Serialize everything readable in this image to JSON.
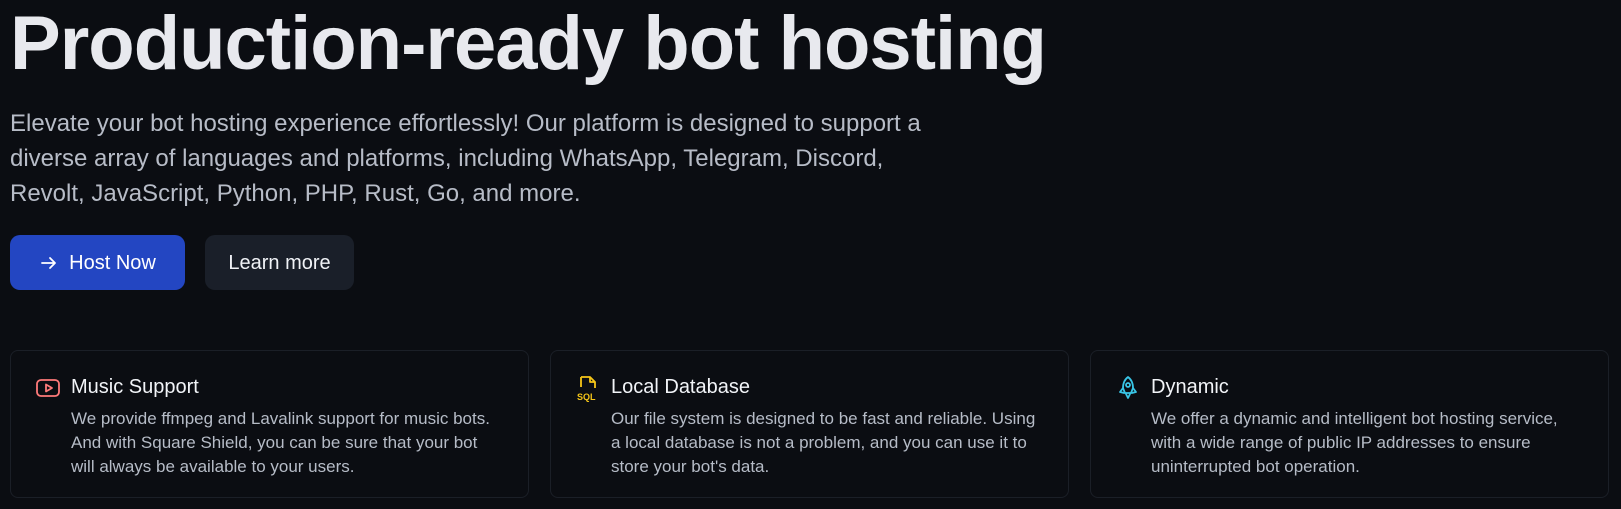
{
  "hero": {
    "title": "Production-ready bot hosting",
    "description": "Elevate your bot hosting experience effortlessly! Our platform is designed to support a diverse array of languages and platforms, including WhatsApp, Telegram, Discord, Revolt, JavaScript, Python, PHP, Rust, Go, and more.",
    "buttons": {
      "primary_label": "Host Now",
      "secondary_label": "Learn more"
    }
  },
  "features": [
    {
      "icon": "play-icon",
      "title": "Music Support",
      "text": "We provide ffmpeg and Lavalink support for music bots. And with Square Shield, you can be sure that your bot will always be available to your users."
    },
    {
      "icon": "sql-file-icon",
      "title": "Local Database",
      "text": "Our file system is designed to be fast and reliable. Using a local database is not a problem, and you can use it to store your bot's data."
    },
    {
      "icon": "rocket-icon",
      "title": "Dynamic",
      "text": "We offer a dynamic and intelligent bot hosting service, with a wide range of public IP addresses to ensure uninterrupted bot operation."
    }
  ],
  "colors": {
    "background": "#0b0d12",
    "primary_button": "#2346c2",
    "secondary_button": "#1a1f29",
    "music_icon": "#ff7a7a",
    "database_icon": "#f5c518",
    "dynamic_icon": "#39c5e6"
  }
}
